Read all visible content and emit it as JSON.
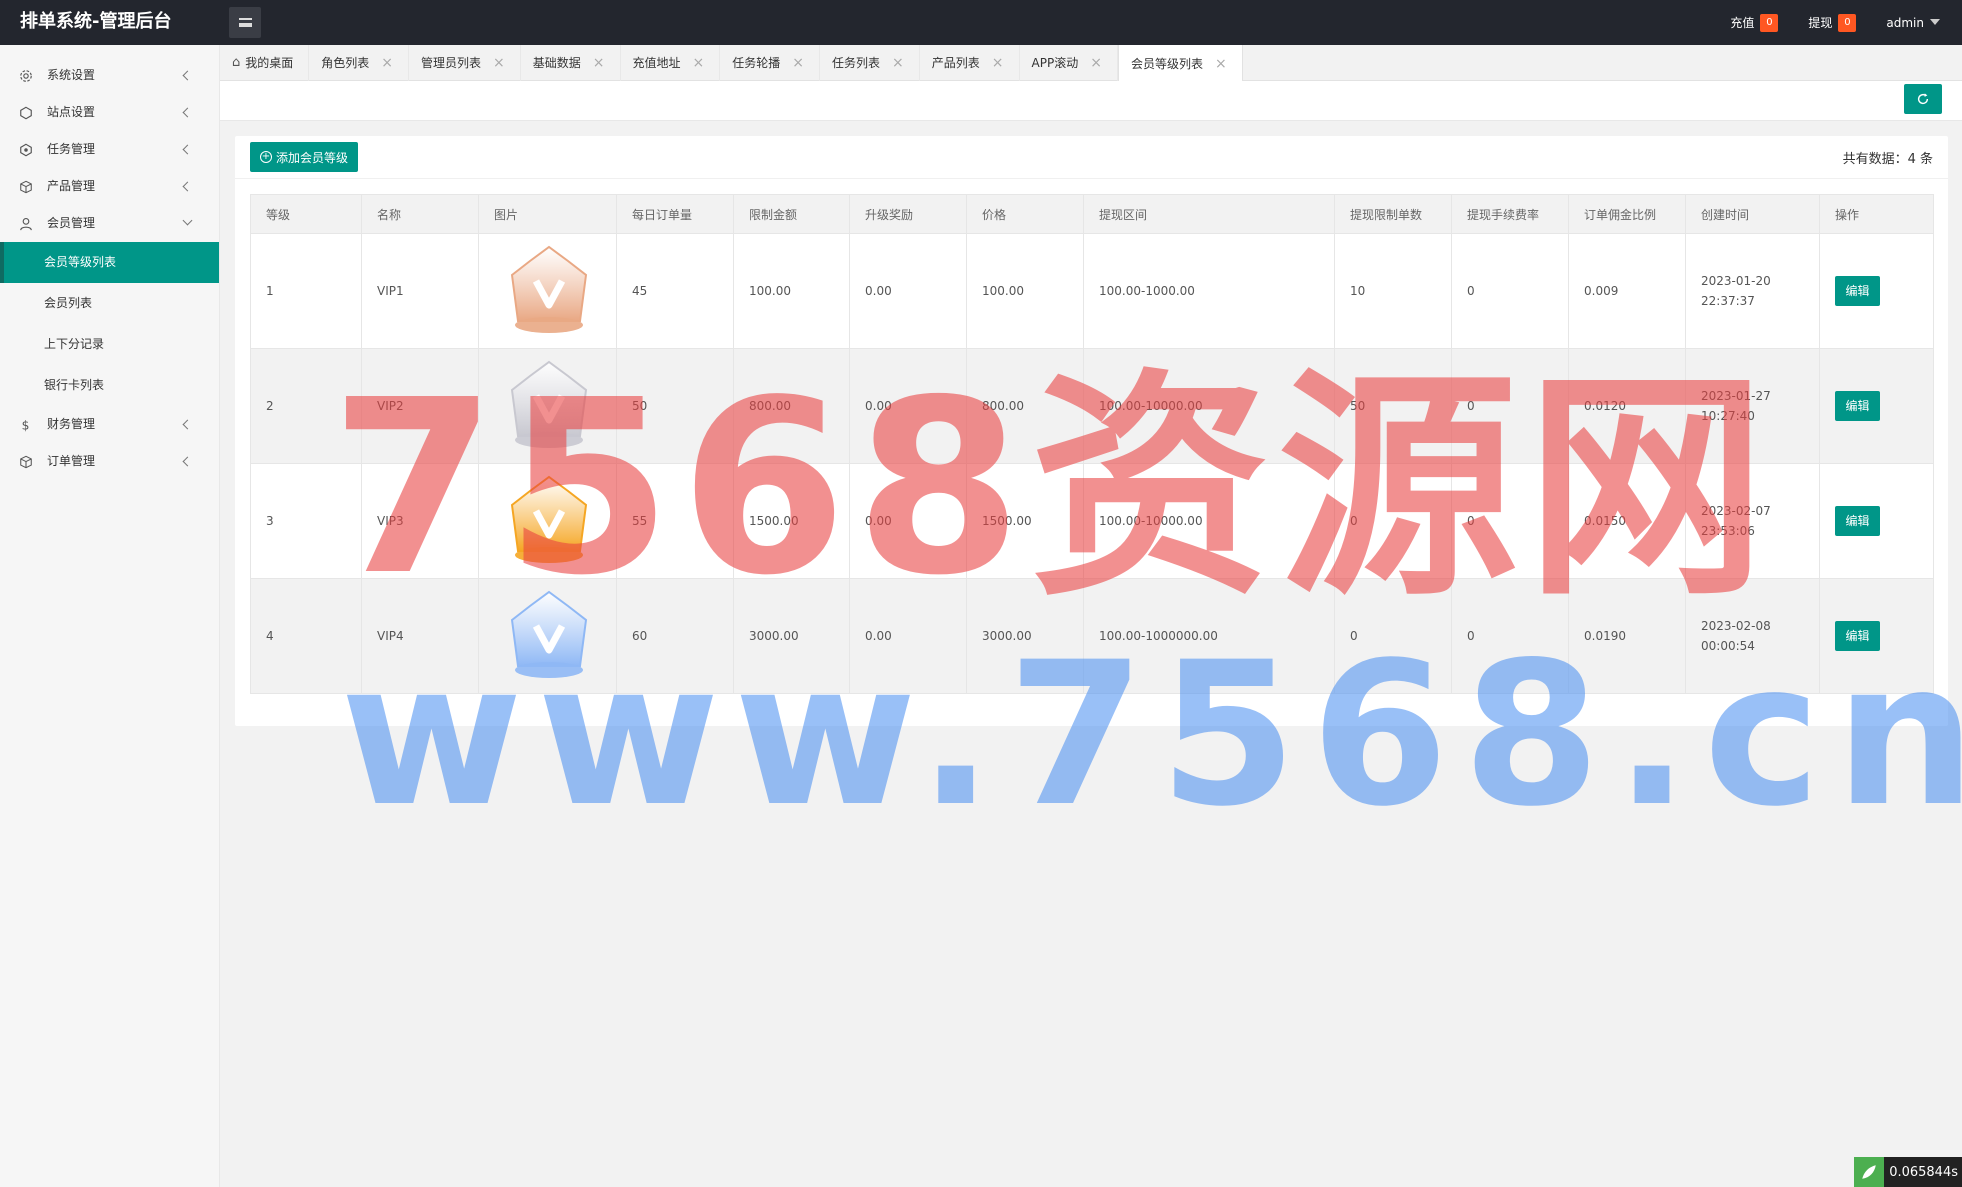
{
  "header": {
    "brand": "排单系统-管理后台",
    "recharge_label": "充值",
    "recharge_count": "0",
    "withdraw_label": "提现",
    "withdraw_count": "0",
    "user": "admin"
  },
  "sidebar": {
    "items": [
      {
        "label": "系统设置",
        "icon": "gear-icon"
      },
      {
        "label": "站点设置",
        "icon": "site-icon"
      },
      {
        "label": "任务管理",
        "icon": "task-icon"
      },
      {
        "label": "产品管理",
        "icon": "box-icon"
      },
      {
        "label": "会员管理",
        "icon": "user-icon"
      },
      {
        "label": "财务管理",
        "icon": "dollar-icon"
      },
      {
        "label": "订单管理",
        "icon": "box-icon"
      }
    ],
    "member_sub": [
      "会员等级列表",
      "会员列表",
      "上下分记录",
      "银行卡列表"
    ]
  },
  "tabs": [
    "我的桌面",
    "角色列表",
    "管理员列表",
    "基础数据",
    "充值地址",
    "任务轮播",
    "任务列表",
    "产品列表",
    "APP滚动",
    "会员等级列表"
  ],
  "toolbar": {
    "add_label": "添加会员等级",
    "total_text": "共有数据：4 条"
  },
  "table": {
    "headers": [
      "等级",
      "名称",
      "图片",
      "每日订单量",
      "限制金额",
      "升级奖励",
      "价格",
      "提现区间",
      "提现限制单数",
      "提现手续费率",
      "订单佣金比例",
      "创建时间",
      "操作"
    ],
    "rows": [
      {
        "level": "1",
        "name": "VIP1",
        "daily": "45",
        "limit": "100.00",
        "reward": "0.00",
        "price": "100.00",
        "range": "100.00-1000.00",
        "wd_count": "10",
        "fee": "0",
        "commission": "0.009",
        "created": "2023-01-20 22:37:37",
        "action": "编辑",
        "crown": "#e9a884"
      },
      {
        "level": "2",
        "name": "VIP2",
        "daily": "50",
        "limit": "800.00",
        "reward": "0.00",
        "price": "800.00",
        "range": "100.00-10000.00",
        "wd_count": "50",
        "fee": "0",
        "commission": "0.0120",
        "created": "2023-01-27 10:27:40",
        "action": "编辑",
        "crown": "#c8c8d0"
      },
      {
        "level": "3",
        "name": "VIP3",
        "daily": "55",
        "limit": "1500.00",
        "reward": "0.00",
        "price": "1500.00",
        "range": "100.00-10000.00",
        "wd_count": "0",
        "fee": "0",
        "commission": "0.0150",
        "created": "2023-02-07 23:53:06",
        "action": "编辑",
        "crown": "#f5a623"
      },
      {
        "level": "4",
        "name": "VIP4",
        "daily": "60",
        "limit": "3000.00",
        "reward": "0.00",
        "price": "3000.00",
        "range": "100.00-1000000.00",
        "wd_count": "0",
        "fee": "0",
        "commission": "0.0190",
        "created": "2023-02-08 00:00:54",
        "action": "编辑",
        "crown": "#8fb8f5"
      }
    ]
  },
  "watermark": {
    "line1": "7568资源网",
    "line2": "www.7568.cn"
  },
  "timer": "0.065844s",
  "colors": {
    "accent": "#009688",
    "topbar": "#23262e",
    "badge": "#ff5722"
  }
}
